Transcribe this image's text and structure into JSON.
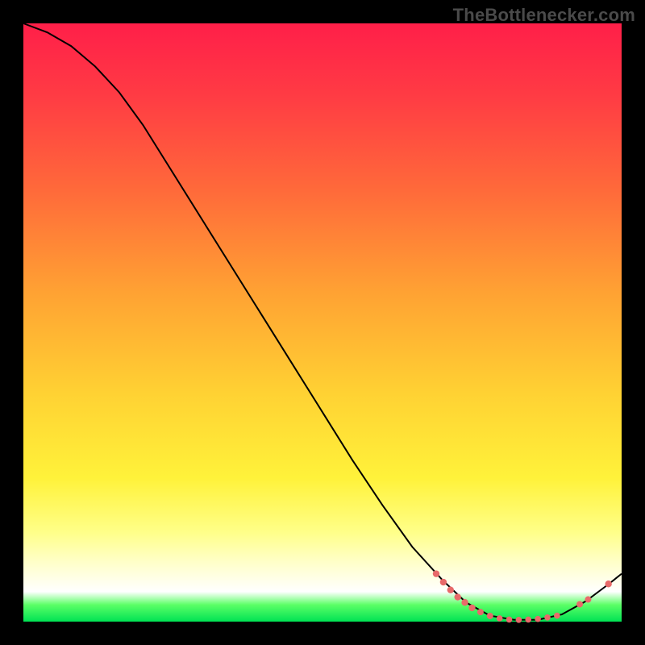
{
  "watermark": "TheBottlenecker.com",
  "chart_data": {
    "type": "line",
    "title": "",
    "xlabel": "",
    "ylabel": "",
    "xlim": [
      0,
      100
    ],
    "ylim": [
      0,
      100
    ],
    "series": [
      {
        "name": "curve",
        "points": [
          {
            "x": 0,
            "y": 100
          },
          {
            "x": 4,
            "y": 98.5
          },
          {
            "x": 8,
            "y": 96.2
          },
          {
            "x": 12,
            "y": 92.8
          },
          {
            "x": 16,
            "y": 88.5
          },
          {
            "x": 20,
            "y": 83.0
          },
          {
            "x": 25,
            "y": 75.0
          },
          {
            "x": 30,
            "y": 67.0
          },
          {
            "x": 35,
            "y": 59.0
          },
          {
            "x": 40,
            "y": 51.0
          },
          {
            "x": 45,
            "y": 43.0
          },
          {
            "x": 50,
            "y": 35.0
          },
          {
            "x": 55,
            "y": 27.0
          },
          {
            "x": 60,
            "y": 19.5
          },
          {
            "x": 65,
            "y": 12.5
          },
          {
            "x": 70,
            "y": 7.0
          },
          {
            "x": 74,
            "y": 3.2
          },
          {
            "x": 78,
            "y": 1.0
          },
          {
            "x": 82,
            "y": 0.3
          },
          {
            "x": 86,
            "y": 0.3
          },
          {
            "x": 90,
            "y": 1.2
          },
          {
            "x": 94,
            "y": 3.4
          },
          {
            "x": 98,
            "y": 6.4
          },
          {
            "x": 100,
            "y": 8.0
          }
        ]
      }
    ],
    "markers": [
      {
        "x": 69.0,
        "y": 8.0,
        "r": 4.2
      },
      {
        "x": 70.2,
        "y": 6.6,
        "r": 4.2
      },
      {
        "x": 71.4,
        "y": 5.3,
        "r": 4.2
      },
      {
        "x": 72.6,
        "y": 4.1,
        "r": 4.2
      },
      {
        "x": 73.8,
        "y": 3.2,
        "r": 4.2
      },
      {
        "x": 75.0,
        "y": 2.3,
        "r": 4.2
      },
      {
        "x": 76.4,
        "y": 1.6,
        "r": 4.0
      },
      {
        "x": 78.0,
        "y": 0.95,
        "r": 4.0
      },
      {
        "x": 79.6,
        "y": 0.55,
        "r": 3.8
      },
      {
        "x": 81.2,
        "y": 0.35,
        "r": 3.8
      },
      {
        "x": 82.8,
        "y": 0.3,
        "r": 3.8
      },
      {
        "x": 84.4,
        "y": 0.35,
        "r": 3.8
      },
      {
        "x": 86.0,
        "y": 0.45,
        "r": 3.8
      },
      {
        "x": 87.6,
        "y": 0.7,
        "r": 3.8
      },
      {
        "x": 89.2,
        "y": 1.0,
        "r": 3.8
      },
      {
        "x": 93.0,
        "y": 2.9,
        "r": 4.0
      },
      {
        "x": 94.4,
        "y": 3.7,
        "r": 4.0
      },
      {
        "x": 97.8,
        "y": 6.3,
        "r": 4.2
      }
    ],
    "gradient_bands_note": "background encodes bottleneck severity: top=red (bad) to bottom=green (good)"
  }
}
